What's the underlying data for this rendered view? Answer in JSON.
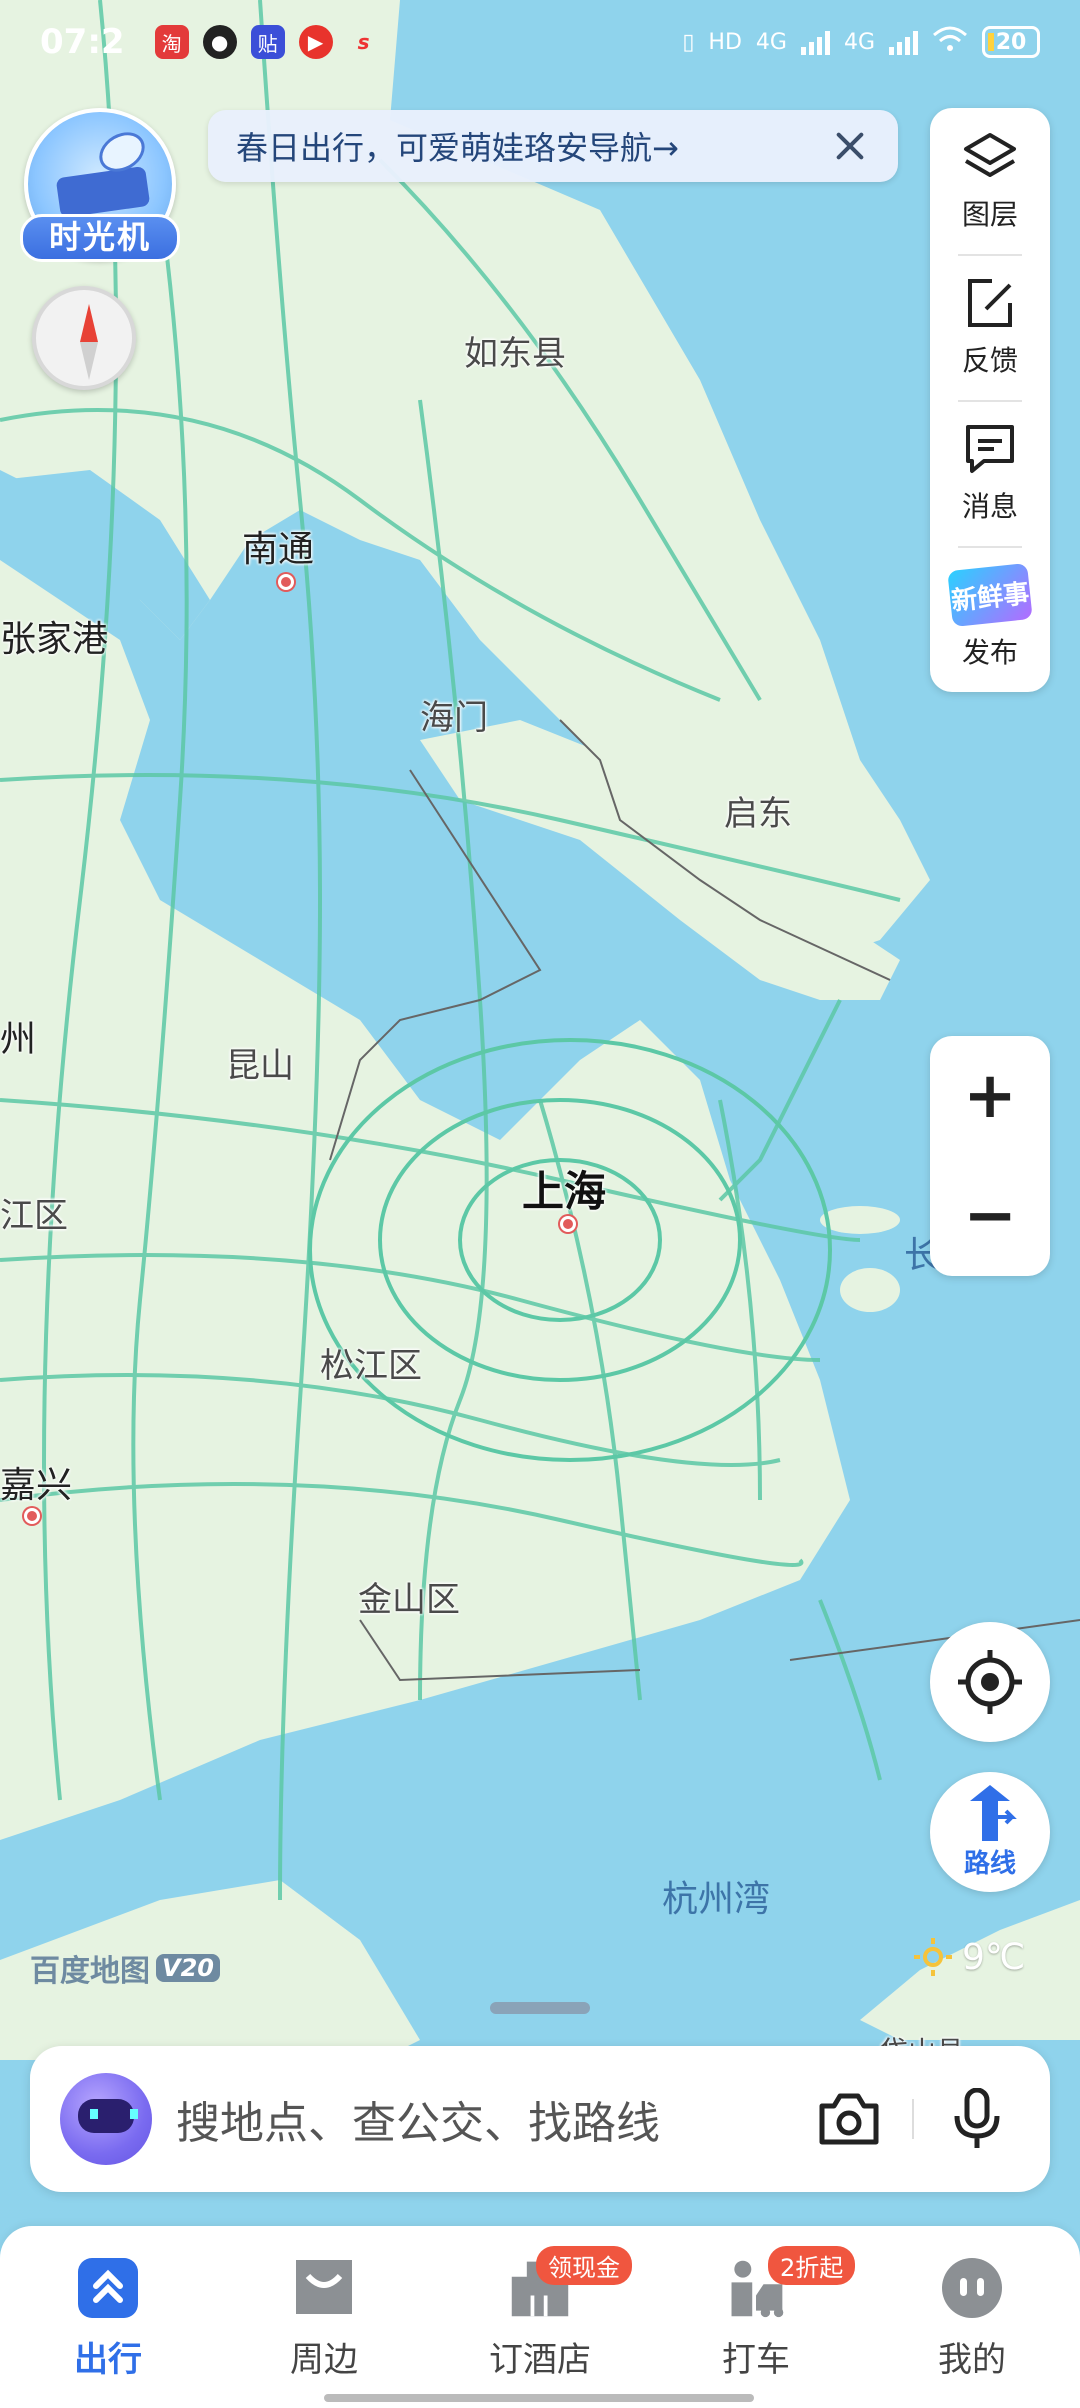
{
  "status_bar": {
    "time": "07:2",
    "battery": "20",
    "network_1": "4G",
    "network_2": "4G",
    "hd": "HD"
  },
  "time_machine": {
    "label": "时光机"
  },
  "banner": {
    "text": "春日出行，可爱萌娃珞安导航→"
  },
  "tool_panel": {
    "layers_label": "图层",
    "feedback_label": "反馈",
    "messages_label": "消息",
    "publish_label": "发布",
    "publish_badge": "新鲜事"
  },
  "map": {
    "labels": {
      "rudong": "如东县",
      "nantong": "南通",
      "zhangjiagang": "张家港",
      "haimen": "海门",
      "qidong": "启东",
      "zhou": "州",
      "kunshan": "昆山",
      "shanghai": "上海",
      "jiangqu": "江区",
      "songjiang": "松江区",
      "jiaxing": "嘉兴",
      "jinshan": "金山区",
      "hangzhouwan": "杭州湾",
      "chang": "长",
      "daishan": "岱山县"
    }
  },
  "zoom": {
    "in": "+",
    "out": "−"
  },
  "route": {
    "label": "路线"
  },
  "watermark": {
    "brand": "百度地图",
    "version": "V20"
  },
  "weather": {
    "temperature": "9℃"
  },
  "search": {
    "placeholder": "搜地点、查公交、找路线"
  },
  "bottom_nav": {
    "items": [
      {
        "label": "出行",
        "active": true
      },
      {
        "label": "周边"
      },
      {
        "label": "订酒店",
        "badge": "领现金"
      },
      {
        "label": "打车",
        "badge": "2折起"
      },
      {
        "label": "我的"
      }
    ]
  },
  "colors": {
    "water": "#8fd3ec",
    "land": "#e6f3e1",
    "road": "#5cc8a6",
    "accent": "#2f6fe8",
    "badge": "#f0563f"
  }
}
